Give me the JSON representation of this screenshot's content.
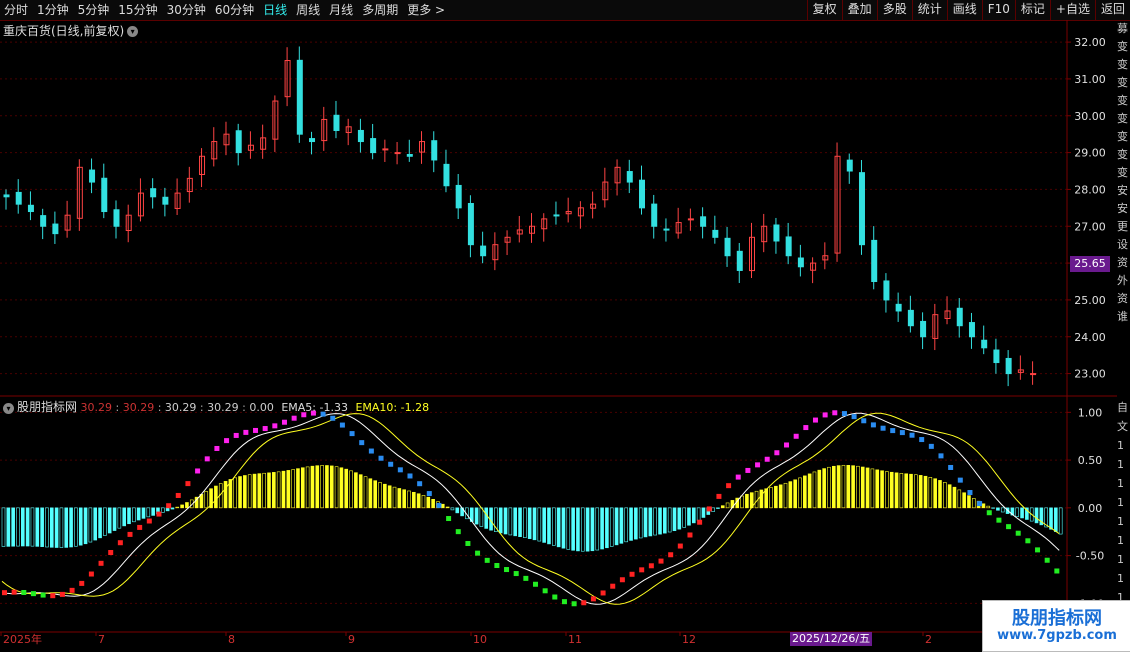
{
  "toolbar": {
    "periods": [
      "分时",
      "1分钟",
      "5分钟",
      "15分钟",
      "30分钟",
      "60分钟",
      "日线",
      "周线",
      "月线",
      "多周期",
      "更多 >"
    ],
    "active_period": "日线",
    "right_buttons": [
      "复权",
      "叠加",
      "多股",
      "统计",
      "画线",
      "F10",
      "标记",
      "+自选",
      "返回"
    ]
  },
  "stock": {
    "title": "重庆百货(日线,前复权)",
    "last_price": "25.65"
  },
  "price_axis": {
    "labels": [
      "32.00",
      "31.00",
      "30.00",
      "29.00",
      "28.00",
      "27.00",
      "26.00",
      "25.00",
      "24.00",
      "23.00"
    ]
  },
  "indicator": {
    "name": "股朋指标网",
    "values": [
      {
        "text": "30.29",
        "color": "#cc3333"
      },
      {
        "text": ":",
        "color": "#aaaaaa"
      },
      {
        "text": "30.29",
        "color": "#cc3333"
      },
      {
        "text": ":",
        "color": "#aaaaaa"
      },
      {
        "text": "30.29",
        "color": "#cccccc"
      },
      {
        "text": ":",
        "color": "#aaaaaa"
      },
      {
        "text": "30.29",
        "color": "#cccccc"
      },
      {
        "text": ":",
        "color": "#aaaaaa"
      },
      {
        "text": "0.00",
        "color": "#cccccc"
      }
    ],
    "ema5_label": "EMA5: -1.33",
    "ema10_label": "EMA10: -1.28",
    "axis_labels": [
      "1.00",
      "0.50",
      "0.00",
      "-0.50",
      "-1.00"
    ]
  },
  "time_axis": {
    "labels": [
      "2025年",
      "7",
      "8",
      "9",
      "10",
      "11",
      "12",
      "2"
    ]
  },
  "crosshair_date": "2025/12/26/五",
  "side_strip_top": [
    "募",
    "变",
    "变",
    "变",
    "变",
    "变",
    "变",
    "变",
    "变",
    "安",
    "安",
    "更",
    "设",
    "资",
    "外",
    "资",
    "谁"
  ],
  "side_strip_bottom": [
    "自",
    "文",
    "1",
    "1",
    "1",
    "1",
    "1",
    "1",
    "1",
    "1",
    "1",
    "1"
  ],
  "watermark": {
    "line1": "股朋指标网",
    "line2": "www.7gpzb.com"
  },
  "colors": {
    "up": "#ff4444",
    "down": "#33e0e0",
    "magenta": "#ff22ee",
    "blue": "#2a8cf0",
    "green": "#22ee22",
    "red": "#ff2222",
    "yellow": "#ffff22",
    "cyan": "#55ffff",
    "grid": "#4a0000",
    "axis": "#7a0000"
  },
  "chart_data": [
    {
      "type": "candlestick",
      "title": "重庆百货(日线,前复权)",
      "ylim": [
        22.5,
        32.6
      ],
      "x": [
        "2025年",
        "7",
        "8",
        "9",
        "10",
        "11",
        "12",
        "2025/12/26/五",
        "2"
      ],
      "close_series": [
        27.8,
        27.6,
        27.4,
        27.0,
        26.8,
        27.3,
        28.6,
        28.2,
        27.4,
        27.0,
        27.3,
        27.9,
        27.8,
        27.6,
        27.9,
        28.3,
        28.9,
        29.3,
        29.5,
        29.0,
        29.2,
        29.4,
        30.4,
        31.5,
        29.5,
        29.3,
        29.9,
        29.6,
        29.7,
        29.3,
        29.0,
        29.1,
        29.0,
        28.9,
        29.3,
        28.8,
        28.1,
        27.5,
        26.5,
        26.2,
        26.5,
        26.7,
        26.9,
        27.0,
        27.2,
        27.3,
        27.4,
        27.5,
        27.6,
        28.2,
        28.6,
        28.2,
        27.5,
        27.0,
        26.9,
        27.1,
        27.2,
        27.0,
        26.7,
        26.2,
        25.8,
        26.7,
        27.0,
        26.6,
        26.2,
        25.9,
        26.0,
        26.2,
        28.9,
        28.5,
        26.5,
        25.5,
        25.0,
        24.7,
        24.3,
        24.0,
        24.6,
        24.7,
        24.3,
        24.0,
        23.7,
        23.3,
        23.0,
        23.1,
        23.0
      ]
    },
    {
      "type": "bar",
      "title": "股朋指标网",
      "ylim": [
        -1.3,
        1.15
      ],
      "series": [
        {
          "name": "EMA5",
          "last": -1.33
        },
        {
          "name": "EMA10",
          "last": -1.28
        }
      ]
    }
  ]
}
